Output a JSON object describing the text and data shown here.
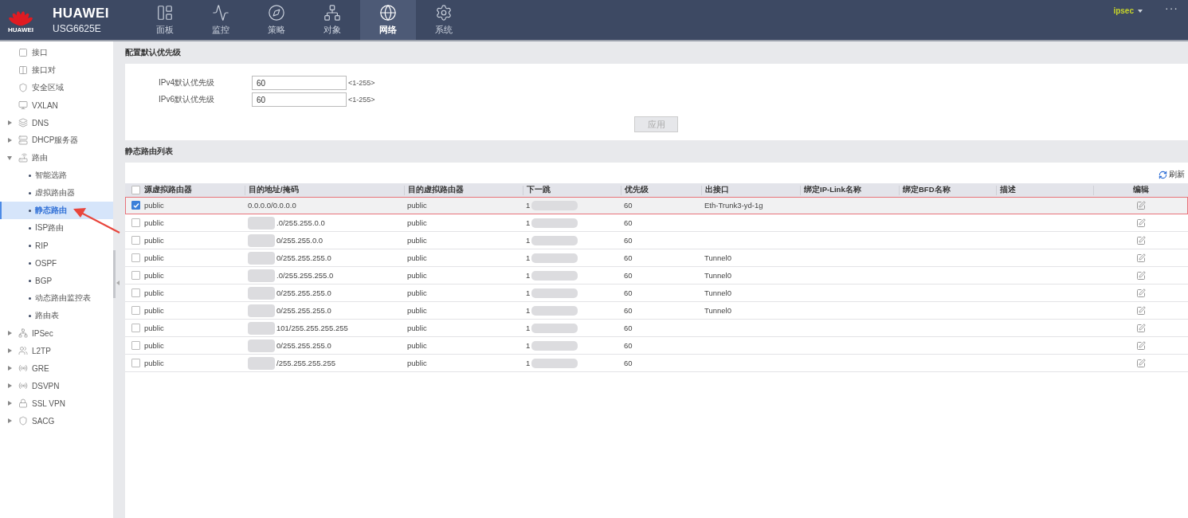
{
  "header": {
    "brand": "HUAWEI",
    "logo_text": "HUAWEI",
    "model": "USG6625E",
    "user": "ipsec",
    "more": "···"
  },
  "nav_tabs": [
    {
      "label": "面板",
      "selected": false
    },
    {
      "label": "监控",
      "selected": false
    },
    {
      "label": "策略",
      "selected": false
    },
    {
      "label": "对象",
      "selected": false
    },
    {
      "label": "网络",
      "selected": true
    },
    {
      "label": "系统",
      "selected": false
    }
  ],
  "sidebar": {
    "items": [
      {
        "label": "接口",
        "kind": "leaf"
      },
      {
        "label": "接口对",
        "kind": "leaf"
      },
      {
        "label": "安全区域",
        "kind": "leaf"
      },
      {
        "label": "VXLAN",
        "kind": "leaf"
      },
      {
        "label": "DNS",
        "kind": "group",
        "expanded": false
      },
      {
        "label": "DHCP服务器",
        "kind": "group",
        "expanded": false
      },
      {
        "label": "路由",
        "kind": "group",
        "expanded": true,
        "children": [
          {
            "label": "智能选路",
            "selected": false
          },
          {
            "label": "虚拟路由器",
            "selected": false
          },
          {
            "label": "静态路由",
            "selected": true
          },
          {
            "label": "ISP路由",
            "selected": false
          },
          {
            "label": "RIP",
            "selected": false
          },
          {
            "label": "OSPF",
            "selected": false
          },
          {
            "label": "BGP",
            "selected": false
          },
          {
            "label": "动态路由监控表",
            "selected": false
          },
          {
            "label": "路由表",
            "selected": false
          }
        ]
      },
      {
        "label": "IPSec",
        "kind": "group",
        "expanded": false
      },
      {
        "label": "L2TP",
        "kind": "group",
        "expanded": false
      },
      {
        "label": "GRE",
        "kind": "group",
        "expanded": false
      },
      {
        "label": "DSVPN",
        "kind": "group",
        "expanded": false
      },
      {
        "label": "SSL VPN",
        "kind": "group",
        "expanded": false
      },
      {
        "label": "SACG",
        "kind": "group",
        "expanded": false
      }
    ]
  },
  "priority_section": {
    "title": "配置默认优先级",
    "fields": [
      {
        "label": "IPv4默认优先级",
        "value": "60",
        "range": "<1-255>"
      },
      {
        "label": "IPv6默认优先级",
        "value": "60",
        "range": "<1-255>"
      }
    ],
    "apply_button": {
      "label": "应用",
      "disabled": true
    }
  },
  "routes_section": {
    "title": "静态路由列表",
    "refresh": "刷新",
    "select_all": {
      "checked": false
    },
    "columns": [
      "源虚拟路由器",
      "目的地址/掩码",
      "目的虚拟路由器",
      "下一跳",
      "优先级",
      "出接口",
      "绑定IP-Link名称",
      "绑定BFD名称",
      "描述",
      "编辑"
    ],
    "rows": [
      {
        "selected": true,
        "source": "public",
        "destination": "0.0.0.0/0.0.0.0",
        "dest_router": "public",
        "next_hop": "1",
        "priority": "60",
        "interface": "Eth-Trunk3-yd-1g"
      },
      {
        "selected": false,
        "source": "public",
        "destination": ".0/255.255.0.0",
        "dest_router": "public",
        "next_hop": "1",
        "priority": "60"
      },
      {
        "selected": false,
        "source": "public",
        "destination": "0/255.255.0.0",
        "dest_router": "public",
        "next_hop": "1",
        "priority": "60"
      },
      {
        "selected": false,
        "source": "public",
        "destination": "0/255.255.255.0",
        "dest_router": "public",
        "next_hop": "1",
        "priority": "60",
        "interface": "Tunnel0"
      },
      {
        "selected": false,
        "source": "public",
        "destination": ".0/255.255.255.0",
        "dest_router": "public",
        "next_hop": "1",
        "priority": "60",
        "interface": "Tunnel0"
      },
      {
        "selected": false,
        "source": "public",
        "destination": "0/255.255.255.0",
        "dest_router": "public",
        "next_hop": "1",
        "priority": "60",
        "interface": "Tunnel0"
      },
      {
        "selected": false,
        "source": "public",
        "destination": "0/255.255.255.0",
        "dest_router": "public",
        "next_hop": "1",
        "priority": "60",
        "interface": "Tunnel0"
      },
      {
        "selected": false,
        "source": "public",
        "destination": "101/255.255.255.255",
        "dest_router": "public",
        "next_hop": "1",
        "priority": "60"
      },
      {
        "selected": false,
        "source": "public",
        "destination": "0/255.255.255.0",
        "dest_router": "public",
        "next_hop": "1",
        "priority": "60"
      },
      {
        "selected": false,
        "source": "public",
        "destination": "/255.255.255.255",
        "dest_router": "public",
        "next_hop": "1",
        "priority": "60"
      }
    ]
  }
}
